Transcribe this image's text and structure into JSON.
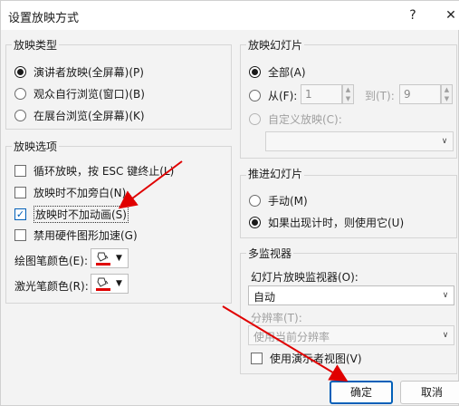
{
  "window": {
    "title": "设置放映方式",
    "help_glyph": "?",
    "close_glyph": "✕"
  },
  "show_type": {
    "title": "放映类型",
    "options": [
      {
        "label": "演讲者放映(全屏幕)(P)",
        "selected": true
      },
      {
        "label": "观众自行浏览(窗口)(B)",
        "selected": false
      },
      {
        "label": "在展台浏览(全屏幕)(K)",
        "selected": false
      }
    ]
  },
  "show_options": {
    "title": "放映选项",
    "checkboxes": [
      {
        "label": "循环放映，按 ESC 键终止(L)",
        "checked": false
      },
      {
        "label": "放映时不加旁白(N)",
        "checked": false
      },
      {
        "label": "放映时不加动画(S)",
        "checked": true
      },
      {
        "label": "禁用硬件图形加速(G)",
        "checked": false
      }
    ],
    "pen_color_label": "绘图笔颜色(E):",
    "laser_color_label": "激光笔颜色(R):",
    "pen_color": "#e00000",
    "laser_color": "#e00000"
  },
  "slides": {
    "title": "放映幻灯片",
    "all_label": "全部(A)",
    "from_label": "从(F):",
    "from_value": "1",
    "to_label": "到(T):",
    "to_value": "9",
    "custom_label": "自定义放映(C):",
    "custom_value": ""
  },
  "advance": {
    "title": "推进幻灯片",
    "manual_label": "手动(M)",
    "timing_label": "如果出现计时，则使用它(U)"
  },
  "monitors": {
    "title": "多监视器",
    "monitor_label": "幻灯片放映监视器(O):",
    "monitor_value": "自动",
    "resolution_label": "分辨率(T):",
    "resolution_value": "使用当前分辨率",
    "presenter_view_label": "使用演示者视图(V)"
  },
  "buttons": {
    "ok": "确定",
    "cancel": "取消"
  },
  "colors": {
    "accent": "#005fb8",
    "annotation_arrow": "#e00000"
  }
}
